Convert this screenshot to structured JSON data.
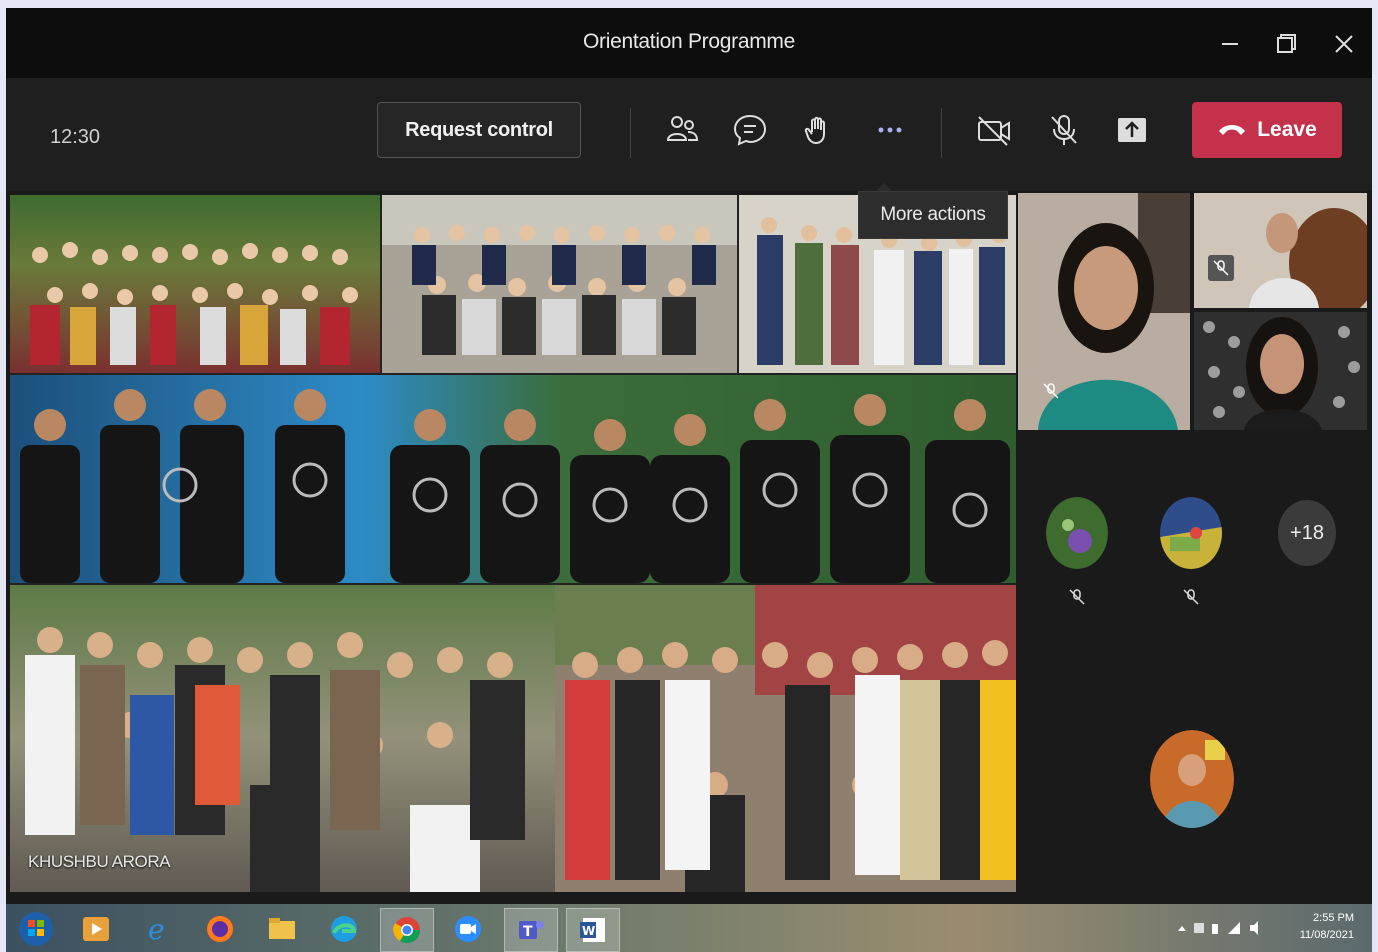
{
  "window": {
    "title": "Orientation Programme"
  },
  "toolbar": {
    "clock": "12:30",
    "request_control_label": "Request control",
    "leave_label": "Leave",
    "tooltip": "More actions"
  },
  "stage": {
    "presenter_name": "KHUSHBU ARORA"
  },
  "participants": {
    "overflow_count": "+18"
  },
  "taskbar": {
    "time": "2:55 PM",
    "date": "11/08/2021"
  },
  "colors": {
    "accent_leave": "#c4314b",
    "window_bg": "#1a1a1a"
  }
}
